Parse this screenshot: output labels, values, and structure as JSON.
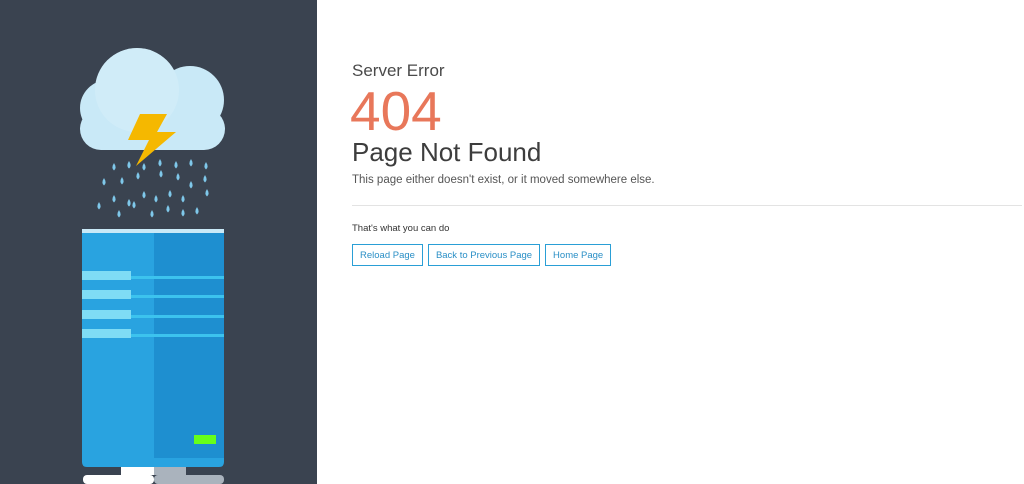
{
  "error": {
    "subtitle": "Server Error",
    "code": "404",
    "title": "Page Not Found",
    "message": "This page either doesn't exist, or it moved somewhere else."
  },
  "actions": {
    "label": "That's what you can do",
    "buttons": [
      {
        "label": "Reload Page"
      },
      {
        "label": "Back to Previous Page"
      },
      {
        "label": "Home Page"
      }
    ]
  },
  "colors": {
    "left_panel_bg": "#3a4350",
    "error_code": "#e8775a",
    "button_border": "#2a9fd6",
    "cloud": "#c9e9f7",
    "lightning": "#f5b800",
    "rain": "#7fc8ea",
    "server_body": "#29a3e0",
    "server_indicator": "#66ff1a"
  },
  "icons": {
    "illustration": "storm-cloud-server-illustration",
    "cloud": "cloud-icon",
    "lightning": "lightning-bolt-icon"
  }
}
